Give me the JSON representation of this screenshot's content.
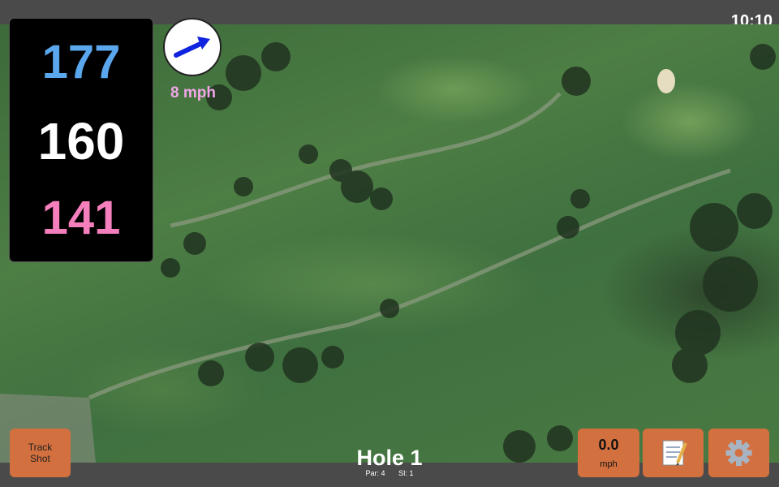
{
  "status_bar": {
    "time": "10:10"
  },
  "yardages": {
    "back": "177",
    "middle": "160",
    "front": "141"
  },
  "wind": {
    "speed_label": "8 mph",
    "arrow_icon": "arrow-right-icon",
    "arrow_color": "#1024e0",
    "speed_color": "#f0a6e6"
  },
  "colors": {
    "back": "#5aa7ee",
    "middle": "#ffffff",
    "front": "#f57fbc",
    "button": "#d3703f",
    "bar": "#4a4a4a"
  },
  "buttons": {
    "track_shot_line1": "Track",
    "track_shot_line2": "Shot",
    "speed_value": "0.0",
    "speed_unit": "mph",
    "notes_icon": "notepad-icon",
    "settings_icon": "gear-icon"
  },
  "hole": {
    "title": "Hole 1",
    "par": "Par: 4",
    "si": "SI: 1"
  }
}
